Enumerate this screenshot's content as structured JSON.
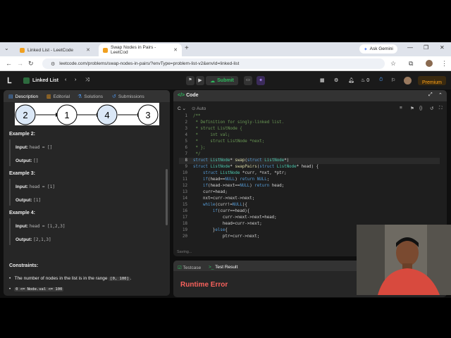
{
  "browser": {
    "tabs": [
      {
        "title": "Linked List - LeetCode"
      },
      {
        "title": "Swap Nodes in Pairs - LeetCod"
      }
    ],
    "new_tab": "+",
    "ask_gemini": "Ask Gemini",
    "url": "leetcode.com/problems/swap-nodes-in-pairs/?envType=problem-list-v2&envId=linked-list"
  },
  "lc": {
    "list_title": "Linked List",
    "submit_label": "Submit",
    "counter": "0",
    "premium_label": "Premium"
  },
  "desc_tabs": [
    {
      "label": "Description"
    },
    {
      "label": "Editorial"
    },
    {
      "label": "Solutions"
    },
    {
      "label": "Submissions"
    }
  ],
  "diagram_nodes": [
    "2",
    "1",
    "4",
    "3"
  ],
  "examples": [
    {
      "title": "Example 2:",
      "input_label": "Input:",
      "input": "head = []",
      "output_label": "Output:",
      "output": "[]"
    },
    {
      "title": "Example 3:",
      "input_label": "Input:",
      "input": "head = [1]",
      "output_label": "Output:",
      "output": "[1]"
    },
    {
      "title": "Example 4:",
      "input_label": "Input:",
      "input": "head = [1,2,3]",
      "output_label": "Output:",
      "output": "[2,1,3]"
    }
  ],
  "constraints": {
    "title": "Constraints:",
    "item1_prefix": "The number of nodes in the list is in the range",
    "item1_code": "[0, 100]",
    "item1_suffix": ".",
    "item2_code": "0 <= Node.val <= 100"
  },
  "code": {
    "title": "Code",
    "lang": "C",
    "mode": "Auto",
    "saving": "Saving..."
  },
  "result": {
    "testcase_tab": "Testcase",
    "result_tab": "Test Result",
    "status": "Runtime Error"
  },
  "colors": {
    "submit_green": "#2cbb5d",
    "error_red": "#f8615c",
    "premium_orange": "#ffa116"
  }
}
